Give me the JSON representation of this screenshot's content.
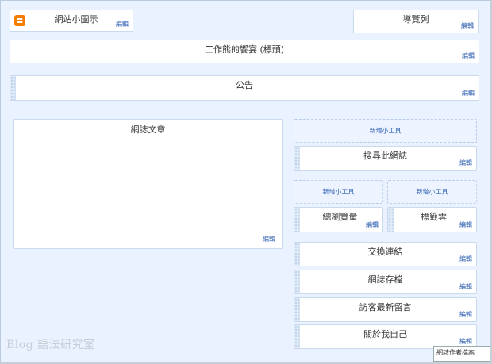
{
  "header": {
    "favicon": {
      "icon": "blogger-icon",
      "color": "#f57d00",
      "title": "網站小圖示",
      "edit": "編輯"
    },
    "navbar": {
      "title": "導覽列",
      "edit": "編輯"
    },
    "title_widget": {
      "title": "工作熊的饗宴 (標頭)",
      "edit": "編輯"
    },
    "notice": {
      "title": "公告",
      "edit": "編輯"
    }
  },
  "main": {
    "posts": {
      "title": "網誌文章",
      "edit": "編輯"
    }
  },
  "sidebar": {
    "add_gadget_top": "新增小工具",
    "search": {
      "title": "搜尋此網誌",
      "edit": "編輯"
    },
    "add_gadget_left": "新增小工具",
    "add_gadget_right": "新增小工具",
    "pageviews": {
      "title": "總瀏覽量",
      "edit": "編輯"
    },
    "labels": {
      "title": "標籤雲",
      "edit": "編輯"
    },
    "links": {
      "title": "交換連結",
      "edit": "編輯"
    },
    "archive": {
      "title": "網誌存檔",
      "edit": "編輯"
    },
    "comments": {
      "title": "訪客最新留言",
      "edit": "編輯"
    },
    "about": {
      "title": "關於我自己",
      "edit": "編輯"
    }
  },
  "watermark": "Blog 語法研究室",
  "tooltip": "網誌作者檔案"
}
